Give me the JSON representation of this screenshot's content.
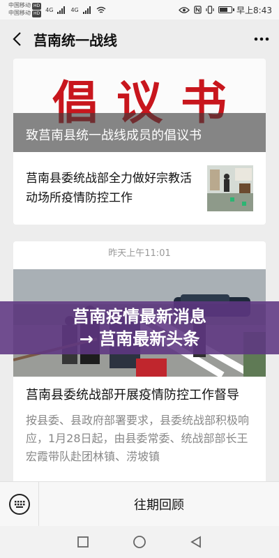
{
  "status_bar": {
    "carrier1": "中国移动",
    "carrier2": "中国移动",
    "network": "4G",
    "hd_badge": "HD",
    "time_label": "早上8:43",
    "battery_level": 0.7
  },
  "nav": {
    "back_icon": "chevron-left-icon",
    "title": "莒南统一战线",
    "more_icon": "more-icon"
  },
  "articles": {
    "cover1_big": "倡议书",
    "cover1_caption": "致莒南县统一战线成员的倡议书",
    "item1_title": "莒南县委统战部全力做好宗教活动场所疫情防控工作",
    "date_label": "昨天上午11:01",
    "card2_title": "莒南县委统战部开展疫情防控工作督导",
    "card2_desc": "按县委、县政府部署要求，县委统战部积极响应，1月28日起，由县委常委、统战部部长王宏霞带队赴团林镇、涝坡镇"
  },
  "overlay": {
    "line1": "莒南疫情最新消息",
    "line2": "→ 莒南最新头条"
  },
  "bottom_bar": {
    "keyboard_icon": "keyboard-icon",
    "menu_label": "往期回顾"
  },
  "system_nav": {
    "recents_icon": "square-icon",
    "home_icon": "circle-icon",
    "back_icon": "triangle-back-icon"
  }
}
